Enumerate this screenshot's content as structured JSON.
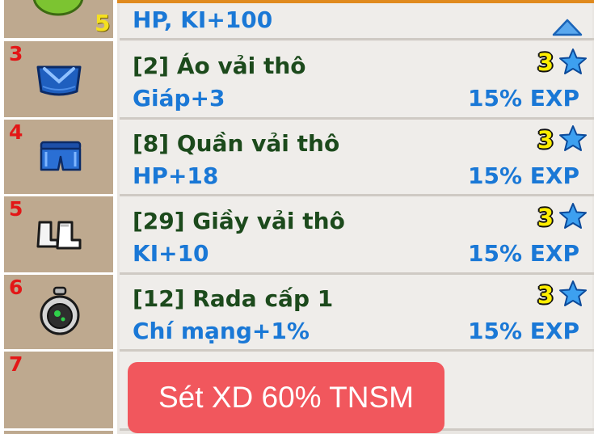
{
  "partial_row": {
    "level": "5",
    "stat": "HP, KI+100",
    "collapse_icon": "triangle-up-icon"
  },
  "items": [
    {
      "slot": "3",
      "icon": "shirt-icon",
      "name": "[2] Áo vải thô",
      "stat": "Giáp+3",
      "stars": "3",
      "exp": "15% EXP"
    },
    {
      "slot": "4",
      "icon": "pants-icon",
      "name": "[8] Quần vải thô",
      "stat": "HP+18",
      "stars": "3",
      "exp": "15% EXP"
    },
    {
      "slot": "5",
      "icon": "boots-icon",
      "name": "[29] Giầy vải thô",
      "stat": "KI+10",
      "stars": "3",
      "exp": "15% EXP"
    },
    {
      "slot": "6",
      "icon": "radar-icon",
      "name": "[12] Rada cấp 1",
      "stat": "Chí mạng+1%",
      "stars": "3",
      "exp": "15% EXP"
    }
  ],
  "empty_slot": {
    "slot": "7"
  },
  "set_bonus_badge": "Sét XD 60% TNSM",
  "colors": {
    "slot_bg": "#bea98f",
    "row_bg": "#efedea",
    "slot_number": "#e31717",
    "item_name": "#1c4a1c",
    "item_stat": "#1a78d6",
    "star_count": "#ffee00",
    "star": "#2c8ee8",
    "badge": "#f1575d",
    "accent": "#e08a1e"
  }
}
